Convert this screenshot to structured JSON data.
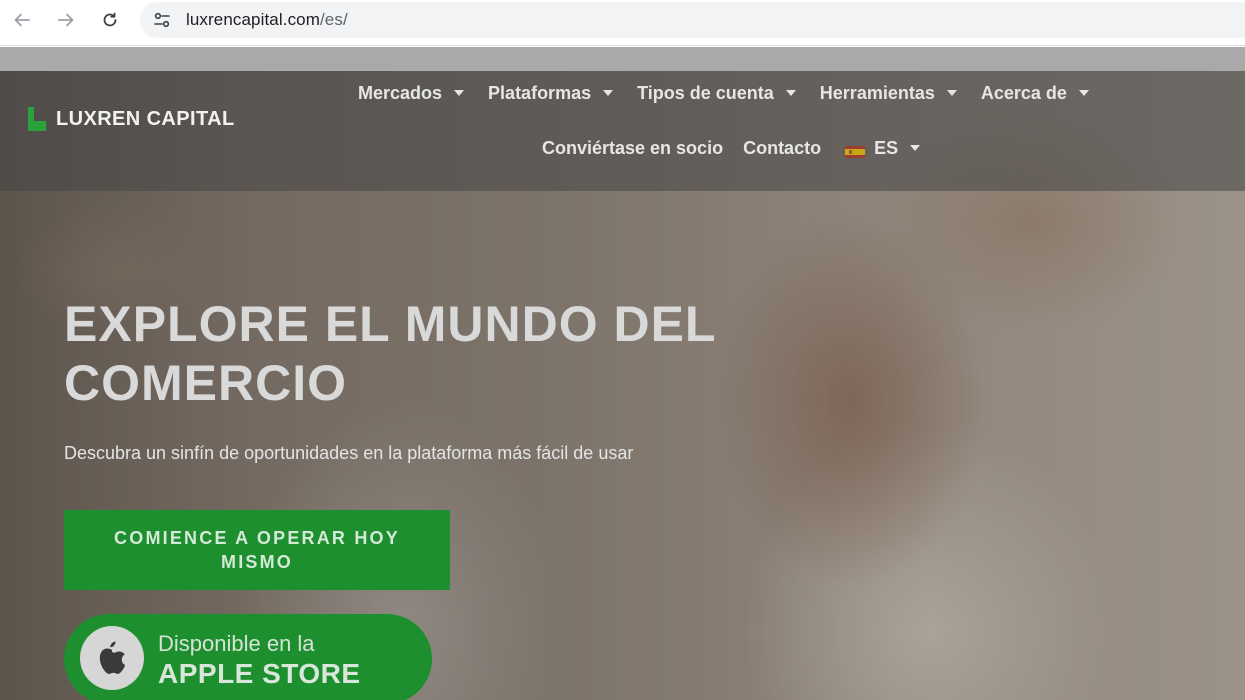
{
  "browser": {
    "url_domain": "luxrencapital.com",
    "url_path": "/es/"
  },
  "header": {
    "logo_text": "LUXREN CAPITAL",
    "menu_row1": [
      {
        "label": "Mercados"
      },
      {
        "label": "Plataformas"
      },
      {
        "label": "Tipos de cuenta"
      },
      {
        "label": "Herramientas"
      },
      {
        "label": "Acerca de"
      }
    ],
    "partner_label": "Conviértase en socio",
    "contact_label": "Contacto",
    "lang_label": "ES"
  },
  "hero": {
    "title": "EXPLORE EL MUNDO DEL COMERCIO",
    "subtitle": "Descubra un sinfín de oportunidades en la plataforma más fácil de usar",
    "cta_label": "COMIENCE A OPERAR HOY MISMO",
    "store_line1": "Disponible en la",
    "store_line2": "APPLE STORE"
  },
  "colors": {
    "brand_green": "#1e8f2e",
    "logo_green": "#2aa13a"
  }
}
